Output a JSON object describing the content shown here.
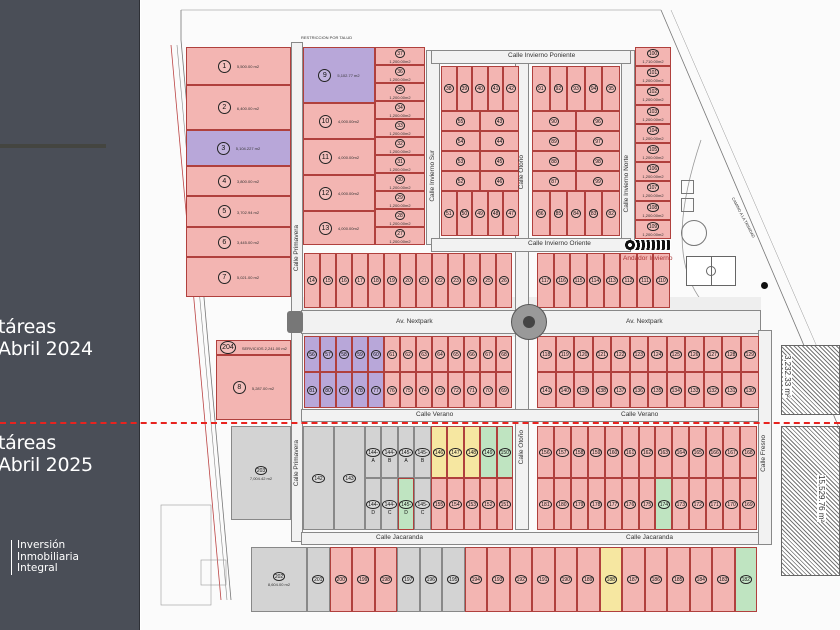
{
  "legend": {
    "period_2024_line1": "táreas",
    "period_2024_line2": "Abril 2024",
    "period_2025_line1": "táreas",
    "period_2025_line2": "Abril 2025",
    "brand_line1": "Inversión",
    "brand_line2": "Inmobiliaria",
    "brand_line3": "Integral"
  },
  "colors": {
    "red": "#f3b5b2",
    "purple": "#b8a7d9",
    "gray": "#d3d3d3",
    "yellow": "#f6e7a1",
    "green": "#bfe4c1",
    "panel": "#4a4e57",
    "divider_line": "#e8231f"
  },
  "streets": {
    "primavera": "Calle Primavera",
    "primavera_2": "Calle Primavera",
    "invierno_poniente": "Calle Invierno Poniente",
    "invierno_oriente": "Calle Invierno Oriente",
    "invierno_sur": "Calle Invierno Sur",
    "invierno_norte": "Calle Invierno Norte",
    "otono": "Calle Otoño",
    "otono_2": "Calle Otoño",
    "nextpark_w": "Av. Nextpark",
    "nextpark_e": "Av. Nextpark",
    "verano_w": "Calle Verano",
    "verano_e": "Calle Verano",
    "jacaranda_w": "Calle Jacaranda",
    "jacaranda_e": "Calle Jacaranda",
    "fresno": "Calle Fresno",
    "andador": "Andador Invierno",
    "camino": "CAMINO A LA TRINIDAD",
    "restriccion": "RESTRICCION POR TALUD"
  },
  "areas": {
    "hatch_north": "3,232.33 m²",
    "hatch_south": "15,529.76 m²"
  },
  "blocks": [
    {
      "id": "west",
      "status": "red",
      "overrides": {
        "3": "purple"
      },
      "rows": [
        [
          "1"
        ],
        [
          "2"
        ],
        [
          "3"
        ],
        [
          "4"
        ],
        [
          "5"
        ],
        [
          "6"
        ],
        [
          "7"
        ]
      ],
      "areas": {
        "1": "5,500.00 m2",
        "2": "6,400.00 m2",
        "3": "5,104.227 m2",
        "4": "3,800.00 m2",
        "5": "3,702.94 m2",
        "6": "3,445.00 m2",
        "7": "5,021.00 m2"
      }
    },
    {
      "id": "w8",
      "status": "red",
      "rows": [
        [
          "204"
        ],
        [
          "8"
        ]
      ],
      "areas": {
        "204": "SERVICIOS 2,241.00 m2",
        "8": "5,287.00 m2"
      }
    },
    {
      "id": "c9",
      "status": "red",
      "overrides": {
        "9": "purple"
      },
      "rows": [
        [
          "9"
        ],
        [
          "10"
        ],
        [
          "11"
        ],
        [
          "12"
        ],
        [
          "13"
        ]
      ],
      "areas": {
        "9": "5,102.77 m2",
        "10": "4,000.00m2",
        "11": "4,000.00m2",
        "12": "4,000.00m2",
        "13": "4,000.00m2"
      }
    },
    {
      "id": "c27",
      "status": "red",
      "rows": [
        [
          "37"
        ],
        [
          "36"
        ],
        [
          "35"
        ],
        [
          "34"
        ],
        [
          "33"
        ],
        [
          "32"
        ],
        [
          "31"
        ],
        [
          "30"
        ],
        [
          "29"
        ],
        [
          "28"
        ],
        [
          "27"
        ]
      ],
      "areas": {
        "37": "1,200.00m2",
        "36": "1,200.00m2",
        "35": "1,200.00m2",
        "34": "1,200.00m2",
        "33": "1,200.00m2",
        "32": "1,200.00m2",
        "31": "1,200.00m2",
        "30": "1,200.00m2",
        "29": "1,200.00m2",
        "28": "1,200.00m2",
        "27": "1,200.00m2"
      }
    },
    {
      "id": "A",
      "status": "red",
      "rows": [
        [
          "38",
          "39",
          "40",
          "41",
          "42"
        ],
        [
          "55",
          "43"
        ],
        [
          "54",
          "44"
        ],
        [
          "53",
          "45"
        ],
        [
          "52",
          "46"
        ],
        [
          "51",
          "50",
          "49",
          "48",
          "47"
        ]
      ]
    },
    {
      "id": "B",
      "status": "red",
      "rows": [
        [
          "91",
          "92",
          "93",
          "94",
          "95"
        ],
        [
          "90",
          "96"
        ],
        [
          "89",
          "97"
        ],
        [
          "88",
          "98"
        ],
        [
          "87",
          "99"
        ],
        [
          "86",
          "85",
          "84",
          "83",
          "82"
        ]
      ]
    },
    {
      "id": "c100",
      "status": "red",
      "rows": [
        [
          "100"
        ],
        [
          "101"
        ],
        [
          "102"
        ],
        [
          "103"
        ],
        [
          "104"
        ],
        [
          "105"
        ],
        [
          "106"
        ],
        [
          "107"
        ],
        [
          "108"
        ],
        [
          "109"
        ]
      ],
      "areas": {
        "100": "1,710.00m2",
        "101": "1,200.00m2",
        "102": "1,200.00m2",
        "103": "1,200.00m2",
        "104": "1,200.00m2",
        "105": "1,200.00m2",
        "106": "1,200.00m2",
        "107": "1,200.00m2",
        "108": "1,200.00m2",
        "109": "1,200.00m2"
      }
    },
    {
      "id": "r14",
      "status": "red",
      "rows": [
        [
          "14",
          "15",
          "16",
          "17",
          "18",
          "19",
          "20",
          "21",
          "22",
          "23",
          "24",
          "25",
          "26"
        ]
      ]
    },
    {
      "id": "r110",
      "status": "red",
      "rows": [
        [
          "117",
          "116",
          "115",
          "114",
          "113",
          "112",
          "111",
          "110"
        ]
      ]
    },
    {
      "id": "L1",
      "status": "red",
      "overrides": {
        "56": "purple",
        "57": "purple",
        "58": "purple",
        "59": "purple",
        "60": "purple",
        "81": "purple",
        "80": "purple",
        "79": "purple",
        "78": "purple",
        "77": "purple"
      },
      "rows": [
        [
          "56",
          "57",
          "58",
          "59",
          "60",
          "61",
          "62",
          "63",
          "64",
          "65",
          "66",
          "67",
          "68"
        ],
        [
          "81",
          "80",
          "79",
          "78",
          "77",
          "76",
          "75",
          "74",
          "73",
          "72",
          "71",
          "70",
          "69"
        ]
      ]
    },
    {
      "id": "R1",
      "status": "red",
      "rows": [
        [
          "118",
          "119",
          "120",
          "121",
          "122",
          "123",
          "124",
          "125",
          "126",
          "127",
          "128",
          "129"
        ],
        [
          "141",
          "140",
          "139",
          "138",
          "137",
          "136",
          "135",
          "134",
          "133",
          "132",
          "131",
          "130"
        ]
      ]
    },
    {
      "id": "LL1",
      "status": "gray",
      "rows": [
        [
          "142",
          "143"
        ]
      ]
    },
    {
      "id": "LL2",
      "status": "gray",
      "overrides": {
        "145-D": "green",
        "146": "yellow",
        "147": "yellow",
        "148": "yellow",
        "149": "green",
        "150": "green",
        "155": "red",
        "154": "red",
        "153": "red",
        "152": "red",
        "151": "red"
      },
      "rows": [
        [
          "144-A",
          "144-B",
          "145-A",
          "145-B",
          "146",
          "147",
          "148",
          "149",
          "150"
        ],
        [
          "144-D",
          "144-C",
          "145-D",
          "145-C",
          "155",
          "154",
          "153",
          "152",
          "151"
        ]
      ]
    },
    {
      "id": "RL",
      "status": "red",
      "overrides": {
        "174": "green"
      },
      "rows": [
        [
          "156",
          "157",
          "158",
          "159",
          "160",
          "161",
          "162",
          "163",
          "164",
          "165",
          "166",
          "167",
          "168"
        ],
        [
          "181",
          "180",
          "179",
          "178",
          "177",
          "176",
          "175",
          "174",
          "173",
          "172",
          "171",
          "170",
          "169"
        ]
      ]
    },
    {
      "id": "BR",
      "status": "red",
      "overrides": {
        "201": "gray",
        "197": "gray",
        "196": "gray",
        "195": "gray",
        "188": "yellow",
        "182": "green"
      },
      "rows": [
        [
          "201",
          "200",
          "199",
          "198",
          "197",
          "196",
          "195",
          "194",
          "193",
          "192",
          "191",
          "190",
          "189",
          "188",
          "187",
          "186",
          "185",
          "184",
          "183",
          "182"
        ]
      ]
    },
    {
      "id": "g203",
      "status": "gray",
      "rows": [
        [
          "203"
        ]
      ],
      "areas": {
        "203": "7,004.42 m2"
      }
    },
    {
      "id": "g202",
      "status": "gray",
      "rows": [
        [
          "202"
        ]
      ],
      "areas": {
        "202": "8,604.00 m2"
      }
    }
  ]
}
